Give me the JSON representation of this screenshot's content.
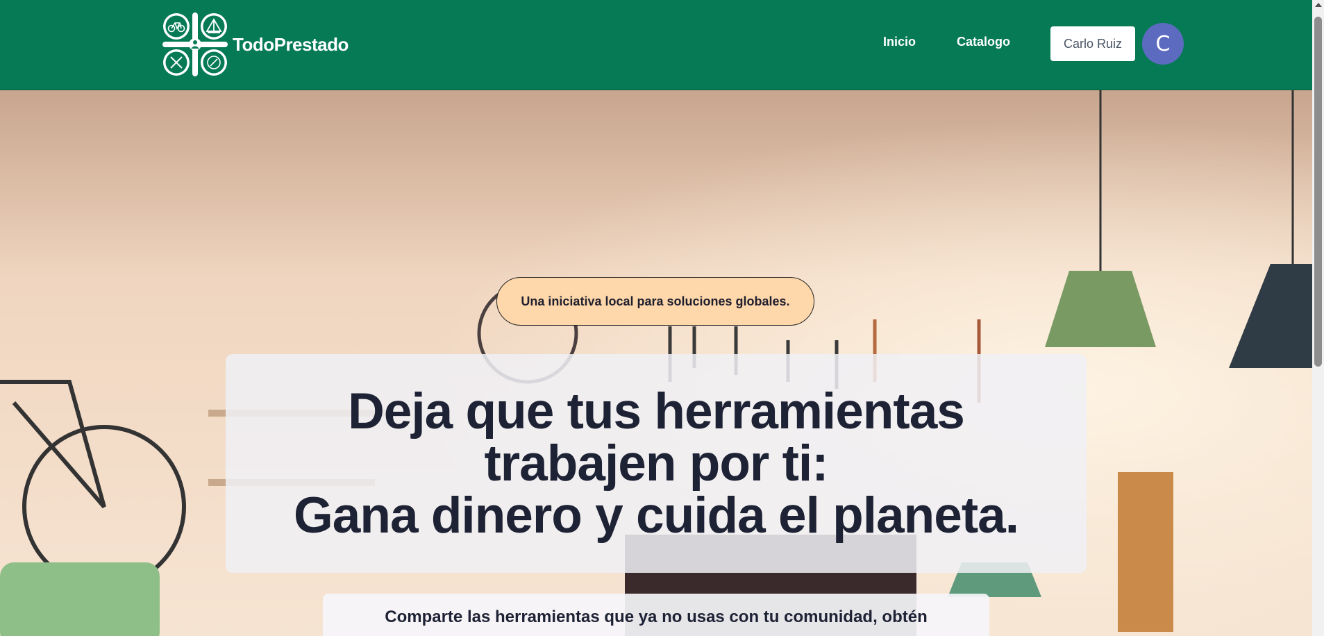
{
  "header": {
    "brand": "TodoPrestado",
    "nav": [
      {
        "label": "Inicio"
      },
      {
        "label": "Catalogo"
      }
    ],
    "user_name": "Carlo Ruiz",
    "avatar_initial": "C"
  },
  "hero": {
    "tagline": "Una iniciativa local para soluciones globales.",
    "headline_lines": [
      "Deja que tus herramientas",
      "trabajen por ti:",
      "Gana dinero y cuida el planeta."
    ],
    "subtext": "Comparte las herramientas que ya no usas con tu comunidad, obtén"
  },
  "colors": {
    "header_bg": "#057a55",
    "tagline_bg": "#fed7aa",
    "avatar_bg": "#5c6bc0",
    "headline_text": "#1e2235"
  },
  "icons": [
    "bicycle-icon",
    "tent-icon",
    "tools-icon",
    "compass-icon",
    "user-icon"
  ]
}
